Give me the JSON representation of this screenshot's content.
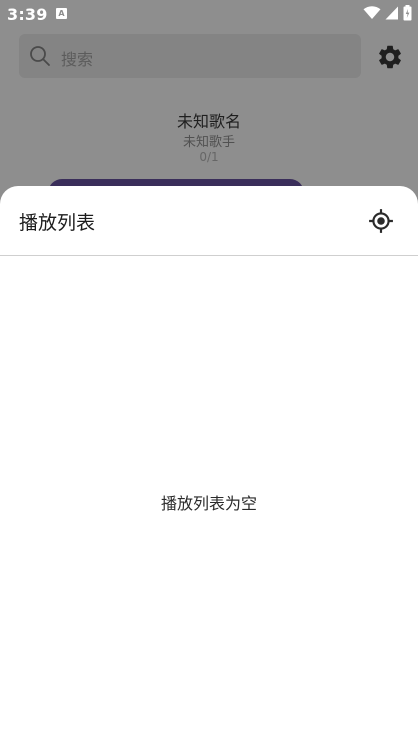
{
  "status_bar": {
    "time": "3:39",
    "notification_icon_letter": "A",
    "icons": [
      "wifi-icon",
      "signal-icon",
      "battery-icon"
    ]
  },
  "background_app": {
    "search": {
      "placeholder": "搜索",
      "icon": "search-icon"
    },
    "settings_icon": "gear-icon",
    "now_playing": {
      "title": "未知歌名",
      "artist": "未知歌手",
      "count": "0/1"
    },
    "accent_color": "#3a2e5a"
  },
  "playlist_sheet": {
    "title": "播放列表",
    "locate_icon": "locate-icon",
    "empty_message": "播放列表为空"
  }
}
